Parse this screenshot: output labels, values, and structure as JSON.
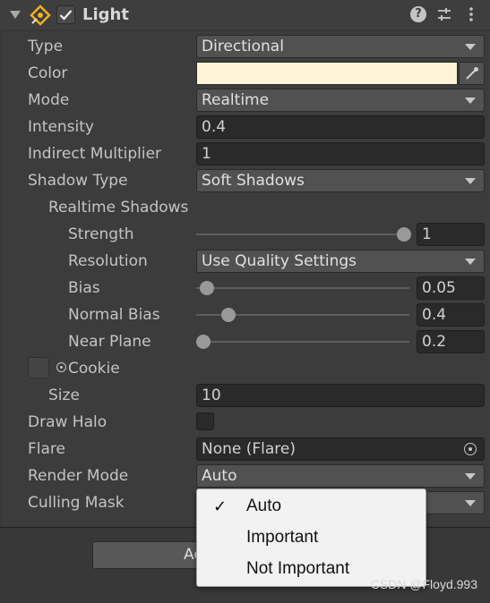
{
  "header": {
    "title": "Light",
    "enabled": true,
    "icons": [
      "foldout-arrow-icon",
      "light-component-icon",
      "help-icon",
      "preset-icon",
      "kebab-menu-icon"
    ]
  },
  "fields": {
    "type_label": "Type",
    "type_value": "Directional",
    "color_label": "Color",
    "color_hex": "#fff3d6",
    "mode_label": "Mode",
    "mode_value": "Realtime",
    "intensity_label": "Intensity",
    "intensity_value": "0.4",
    "indirect_label": "Indirect Multiplier",
    "indirect_value": "1",
    "shadow_type_label": "Shadow Type",
    "shadow_type_value": "Soft Shadows",
    "realtime_shadows_label": "Realtime Shadows",
    "strength_label": "Strength",
    "strength_value": "1",
    "resolution_label": "Resolution",
    "resolution_value": "Use Quality Settings",
    "bias_label": "Bias",
    "bias_value": "0.05",
    "normal_bias_label": "Normal Bias",
    "normal_bias_value": "0.4",
    "near_plane_label": "Near Plane",
    "near_plane_value": "0.2",
    "cookie_label": "Cookie",
    "size_label": "Size",
    "size_value": "10",
    "draw_halo_label": "Draw Halo",
    "draw_halo_checked": false,
    "flare_label": "Flare",
    "flare_value": "None (Flare)",
    "render_mode_label": "Render Mode",
    "render_mode_value": "Auto",
    "culling_mask_label": "Culling Mask"
  },
  "sliders": {
    "strength_fraction": 1.0,
    "bias_fraction": 0.05,
    "normal_bias_fraction": 0.13,
    "near_plane_fraction": 0.03
  },
  "bottom": {
    "button_label": "Ad"
  },
  "dropdown_menu": {
    "items": [
      {
        "label": "Auto",
        "checked": true
      },
      {
        "label": "Important",
        "checked": false
      },
      {
        "label": "Not Important",
        "checked": false
      }
    ]
  },
  "watermark": "CSDN @Floyd.993"
}
